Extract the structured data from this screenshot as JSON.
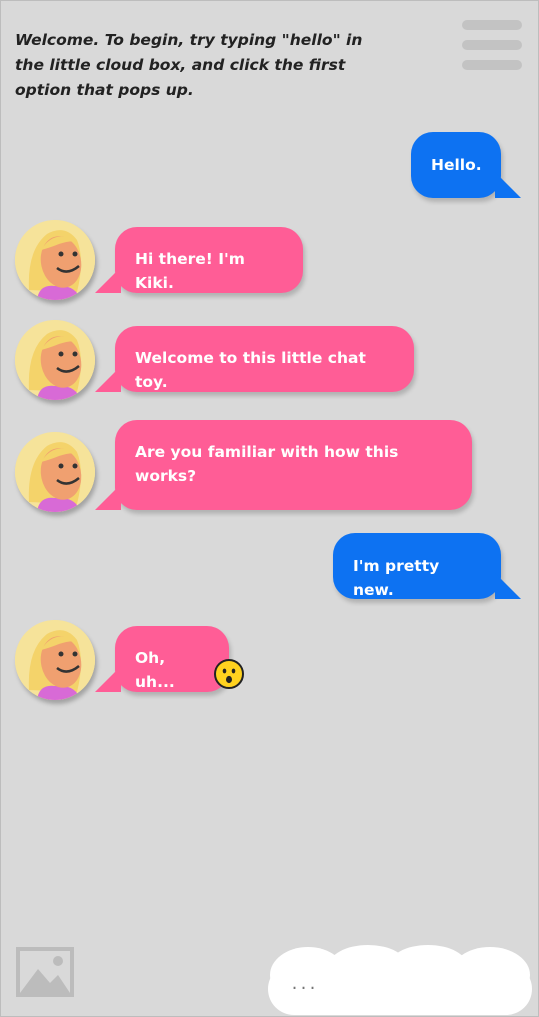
{
  "intro": {
    "line1": "Welcome. To begin, try typing \"hello\" in",
    "line2": "the little cloud box, and click the first",
    "line3": "option that pops up."
  },
  "menu_icon": "hamburger-menu-icon",
  "messages": [
    {
      "from": "user",
      "lines": [
        "Hello."
      ]
    },
    {
      "from": "bot",
      "lines": [
        "Hi there! I'm Kiki."
      ]
    },
    {
      "from": "bot",
      "lines": [
        "Welcome to this little chat toy."
      ]
    },
    {
      "from": "bot",
      "lines": [
        "Are you familiar with how this",
        "works?"
      ]
    },
    {
      "from": "user",
      "lines": [
        "I'm pretty new."
      ]
    },
    {
      "from": "bot",
      "lines": [
        "Oh, uh..."
      ],
      "reaction": "surprised-face-emoji"
    }
  ],
  "input": {
    "placeholder": "..."
  },
  "colors": {
    "background": "#d9d9d9",
    "bot_bubble": "#ff5d96",
    "user_bubble": "#0d72f2",
    "avatar_bg": "#f6e39a"
  }
}
